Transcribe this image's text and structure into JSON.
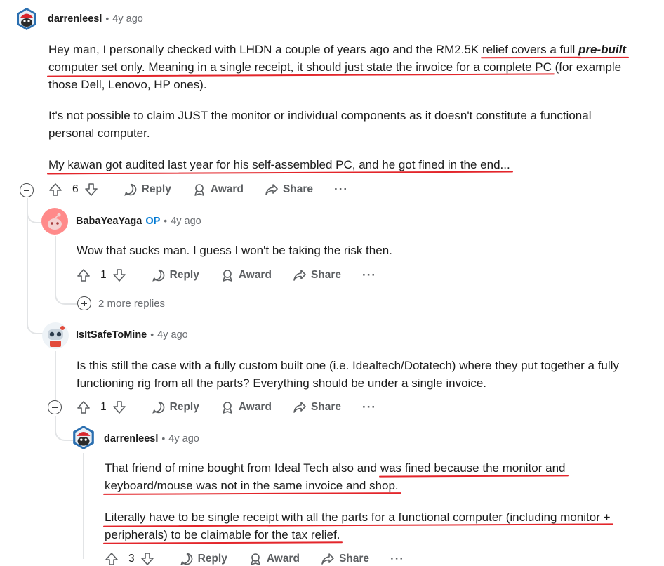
{
  "comments": [
    {
      "author": "darrenleesl",
      "time": "4y ago",
      "paragraphs": [
        {
          "lines": [
            [
              {
                "t": "Hey man, I personally checked with LHDN a couple of years ago and the RM2.5K "
              },
              {
                "t": "relief covers a full ",
                "u": true
              },
              {
                "t": "pre-built",
                "u": true,
                "b": true
              }
            ],
            [
              {
                "t": "computer set only. Meaning in a single receipt, it should just state the invoice for a complete PC",
                "u": true
              },
              {
                "t": " (for example"
              }
            ],
            [
              {
                "t": "those Dell, Lenovo, HP ones)."
              }
            ]
          ]
        },
        {
          "lines": [
            [
              {
                "t": "It's not possible to claim JUST the monitor or individual components as it doesn't constitute a functional"
              }
            ],
            [
              {
                "t": "personal computer."
              }
            ]
          ]
        },
        {
          "lines": [
            [
              {
                "t": "My kawan got audited last year for his self-assembled PC, and he got fined in the end...",
                "u": true
              }
            ]
          ]
        }
      ],
      "votes": "6",
      "reply": "Reply",
      "award": "Award",
      "share": "Share",
      "more": "···"
    },
    {
      "author": "BabaYeaYaga",
      "badge": "OP",
      "time": "4y ago",
      "paragraphs": [
        {
          "lines": [
            [
              {
                "t": "Wow that sucks man. I guess I won't be taking the risk then."
              }
            ]
          ]
        }
      ],
      "votes": "1",
      "reply": "Reply",
      "award": "Award",
      "share": "Share",
      "more": "···",
      "more_replies": "2 more replies"
    },
    {
      "author": "IsItSafeToMine",
      "time": "4y ago",
      "paragraphs": [
        {
          "lines": [
            [
              {
                "t": "Is this still the case with a fully custom built one (i.e. Idealtech/Dotatech) where they put together a fully"
              }
            ],
            [
              {
                "t": "functioning rig from all the parts? Everything should be under a single invoice."
              }
            ]
          ]
        }
      ],
      "votes": "1",
      "reply": "Reply",
      "award": "Award",
      "share": "Share",
      "more": "···"
    },
    {
      "author": "darrenleesl",
      "time": "4y ago",
      "paragraphs": [
        {
          "lines": [
            [
              {
                "t": "That friend of mine bought from Ideal Tech also and "
              },
              {
                "t": "was fined because the monitor and",
                "u": true
              }
            ],
            [
              {
                "t": "keyboard/mouse was not in the same invoice and shop.",
                "u": true
              }
            ]
          ]
        },
        {
          "lines": [
            [
              {
                "t": "Literally have to be single receipt with all the parts for a functional computer (including monitor +",
                "u": true
              }
            ],
            [
              {
                "t": "peripherals) to be claimable for the tax relief.",
                "u": true
              }
            ]
          ]
        }
      ],
      "votes": "3",
      "reply": "Reply",
      "award": "Award",
      "share": "Share",
      "more": "···"
    }
  ]
}
